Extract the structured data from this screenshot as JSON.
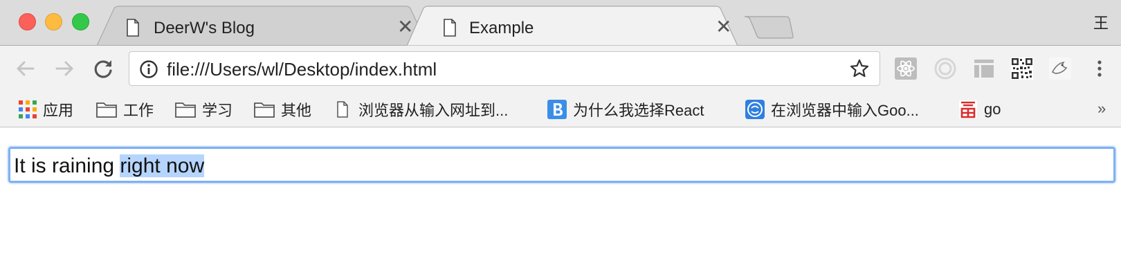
{
  "browser": {
    "profile_label": "王",
    "tabs": [
      {
        "title": "DeerW's Blog",
        "active": false
      },
      {
        "title": "Example",
        "active": true
      }
    ],
    "omnibox": {
      "url": "file:///Users/wl/Desktop/index.html"
    },
    "extensions": [
      "react-devtools-icon",
      "circle-extension-icon",
      "layout-extension-icon",
      "qr-code-icon",
      "bird-extension-icon"
    ]
  },
  "bookmarks": {
    "items": [
      {
        "label": "应用",
        "icon": "apps-grid-icon"
      },
      {
        "label": "工作",
        "icon": "folder-icon"
      },
      {
        "label": "学习",
        "icon": "folder-icon"
      },
      {
        "label": "其他",
        "icon": "folder-icon"
      },
      {
        "label": "浏览器从输入网址到...",
        "icon": "page-icon"
      },
      {
        "label": "为什么我选择React",
        "icon": "b-logo-icon"
      },
      {
        "label": "在浏览器中输入Goo...",
        "icon": "globe-logo-icon"
      },
      {
        "label": "go",
        "icon": "red-char-icon"
      }
    ],
    "more": "»"
  },
  "page": {
    "input_text_unselected": "It is raining ",
    "input_text_selected": "right now"
  },
  "colors": {
    "tabstrip": "#dcdcdc",
    "toolbar": "#f2f2f2",
    "focus_ring": "#7fb1f2",
    "selection": "#b6d5fc"
  }
}
